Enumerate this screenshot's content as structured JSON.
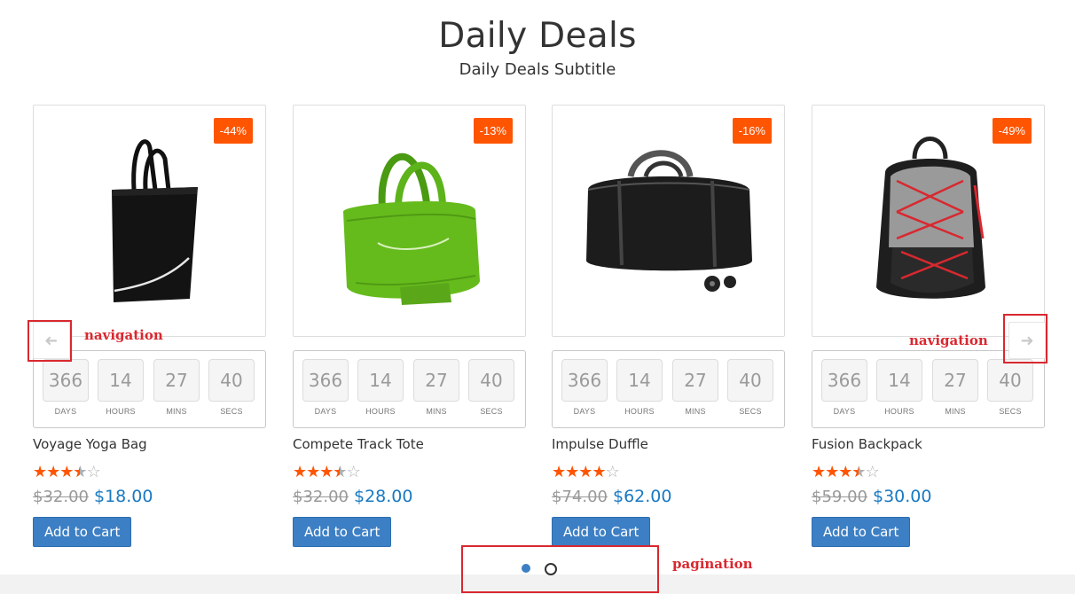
{
  "header": {
    "title": "Daily Deals",
    "subtitle": "Daily Deals Subtitle"
  },
  "countdown_labels": [
    "DAYS",
    "HOURS",
    "MINS",
    "SECS"
  ],
  "products": [
    {
      "name": "Voyage Yoga Bag",
      "discount": "-44%",
      "old_price": "$32.00",
      "new_price": "$18.00",
      "rating": 3.5,
      "countdown": [
        "366",
        "14",
        "27",
        "40"
      ],
      "cart_label": "Add to Cart",
      "image": "black-tote-bag"
    },
    {
      "name": "Compete Track Tote",
      "discount": "-13%",
      "old_price": "$32.00",
      "new_price": "$28.00",
      "rating": 3.5,
      "countdown": [
        "366",
        "14",
        "27",
        "40"
      ],
      "cart_label": "Add to Cart",
      "image": "green-tote-bag"
    },
    {
      "name": "Impulse Duffle",
      "discount": "-16%",
      "old_price": "$74.00",
      "new_price": "$62.00",
      "rating": 4,
      "countdown": [
        "366",
        "14",
        "27",
        "40"
      ],
      "cart_label": "Add to Cart",
      "image": "black-duffle-bag"
    },
    {
      "name": "Fusion Backpack",
      "discount": "-49%",
      "old_price": "$59.00",
      "new_price": "$30.00",
      "rating": 3.5,
      "countdown": [
        "366",
        "14",
        "27",
        "40"
      ],
      "cart_label": "Add to Cart",
      "image": "grey-backpack"
    }
  ],
  "navigation": {
    "prev_icon": "arrow-left-icon",
    "next_icon": "arrow-right-icon"
  },
  "pagination": {
    "pages": 2,
    "active": 0
  },
  "annotations": {
    "nav_left": "navigation",
    "nav_right": "navigation",
    "pagination": "pagination",
    "color": "#d9282f"
  },
  "colors": {
    "badge": "#ff5501",
    "star": "#ff5501",
    "price": "#1979c3",
    "button": "#3c7fc4"
  }
}
